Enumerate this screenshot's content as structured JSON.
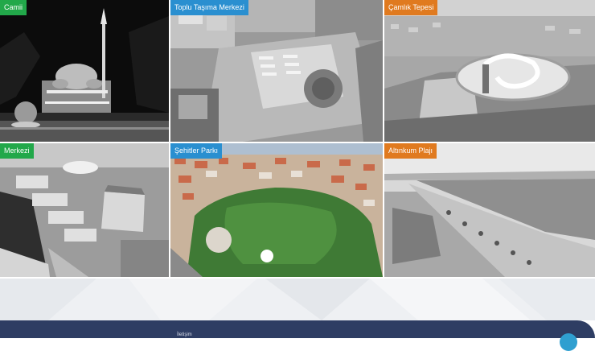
{
  "gallery": {
    "tiles": [
      {
        "label": "Camii",
        "tag_color": "#22a84a",
        "scene": "mosque-night"
      },
      {
        "label": "Toplu Taşıma Merkezi",
        "tag_color": "#2a8fd0",
        "scene": "bus-terminal"
      },
      {
        "label": "Çamlık Tepesi",
        "tag_color": "#e07a1f",
        "scene": "hill-complex"
      },
      {
        "label": "Merkezi",
        "tag_color": "#22a84a",
        "scene": "industrial-center"
      },
      {
        "label": "Şehitler Parkı",
        "tag_color": "#2a8fd0",
        "scene": "city-park"
      },
      {
        "label": "Altınkum Plajı",
        "tag_color": "#e07a1f",
        "scene": "beach"
      }
    ]
  },
  "footer": {
    "label": "İletişim",
    "background": "#2e3d63",
    "accent": "#2f9fd0"
  }
}
